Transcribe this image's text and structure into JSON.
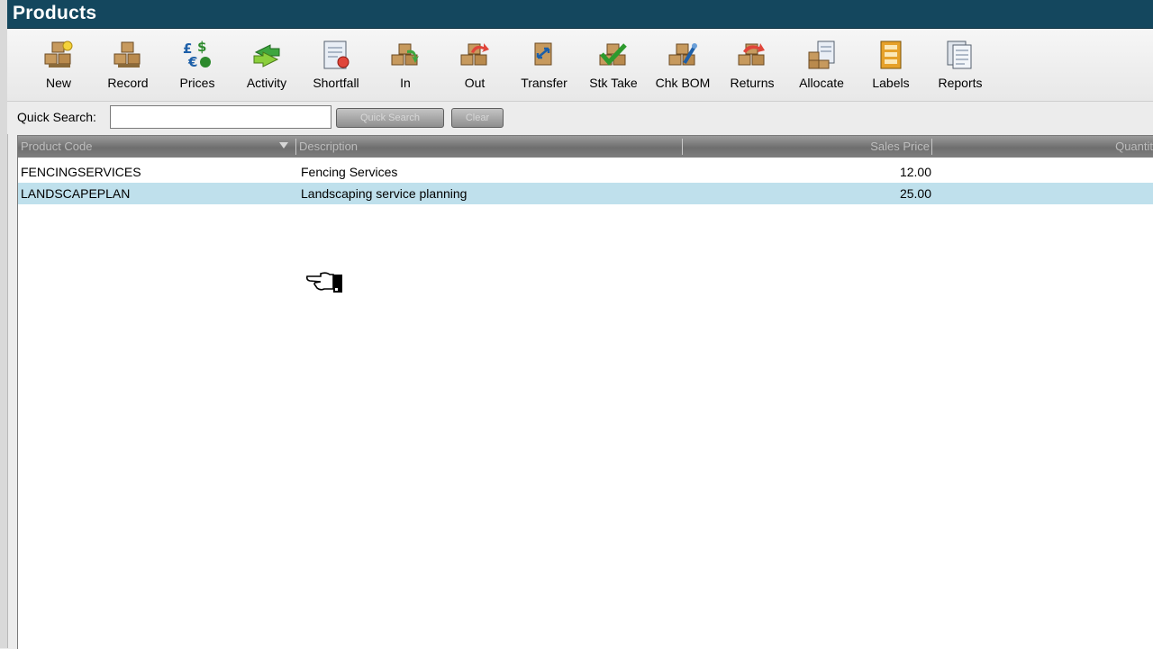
{
  "window": {
    "title": "Products"
  },
  "toolbar": {
    "buttons": [
      {
        "label": "New",
        "icon": "boxes-new-icon"
      },
      {
        "label": "Record",
        "icon": "boxes-record-icon"
      },
      {
        "label": "Prices",
        "icon": "currency-prices-icon"
      },
      {
        "label": "Activity",
        "icon": "arrows-activity-icon"
      },
      {
        "label": "Shortfall",
        "icon": "shortfall-report-icon"
      },
      {
        "label": "In",
        "icon": "stock-in-icon"
      },
      {
        "label": "Out",
        "icon": "stock-out-icon"
      },
      {
        "label": "Transfer",
        "icon": "transfer-icon"
      },
      {
        "label": "Stk Take",
        "icon": "stock-take-icon"
      },
      {
        "label": "Chk BOM",
        "icon": "check-bom-icon"
      },
      {
        "label": "Returns",
        "icon": "returns-icon"
      },
      {
        "label": "Allocate",
        "icon": "allocate-icon"
      },
      {
        "label": "Labels",
        "icon": "labels-icon"
      },
      {
        "label": "Reports",
        "icon": "reports-icon"
      }
    ]
  },
  "search": {
    "label": "Quick Search:",
    "value": "",
    "search_button": "Quick Search",
    "clear_button": "Clear"
  },
  "grid": {
    "columns": [
      "Product Code",
      "Description",
      "Sales Price",
      "Quantit"
    ],
    "sort_column": "Product Code",
    "rows": [
      {
        "code": "FENCINGSERVICES",
        "description": "Fencing Services",
        "price": "12.00",
        "selected": false
      },
      {
        "code": "LANDSCAPEPLAN",
        "description": "Landscaping service planning",
        "price": "25.00",
        "selected": true
      }
    ]
  },
  "colors": {
    "titlebar": "#14475e",
    "selected_row": "#bfe0ec",
    "header": "#7f7f7f"
  }
}
